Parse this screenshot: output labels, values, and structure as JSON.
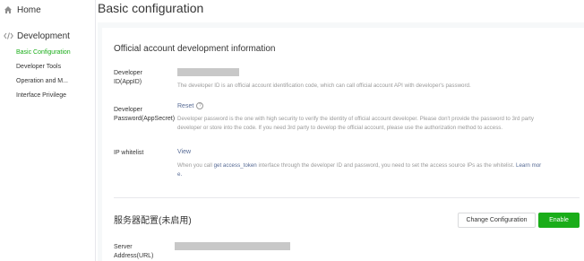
{
  "sidebar": {
    "home_label": "Home",
    "development_label": "Development",
    "items": [
      {
        "label": "Basic Configuration"
      },
      {
        "label": "Developer Tools"
      },
      {
        "label": "Operation and M..."
      },
      {
        "label": "Interface Privilege"
      }
    ]
  },
  "page": {
    "title": "Basic configuration"
  },
  "dev_info": {
    "section_title": "Official account development information",
    "appid": {
      "label_line1": "Developer",
      "label_line2": "ID(AppID)",
      "desc": "The developer ID is an official account identification code, which can call official account API with developer's password."
    },
    "appsecret": {
      "label_line1": "Developer",
      "label_line2": "Password(AppSecret)",
      "action": "Reset",
      "help_icon": "?",
      "desc_line1": "Developer password is the one with high security to verify the identity of official account developer. Please don't provide the password to 3rd party",
      "desc_line2": "developer or store into the code. If you need 3rd party to develop the official account, please use the authorization method to access."
    },
    "whitelist": {
      "label": "IP whitelist",
      "action": "View",
      "desc_pre": "When you call ",
      "desc_link": "get access_token",
      "desc_post": " interface through the developer ID and password, you need to set the access source IPs as the whitelist.",
      "desc_learn": "Learn mor",
      "desc_learn2": "e."
    }
  },
  "server": {
    "section_title": "服务器配置(未启用)",
    "change_button": "Change Configuration",
    "enable_button": "Enable",
    "url_label_line1": "Server",
    "url_label_line2": "Address(URL)"
  },
  "colors": {
    "accent": "#1aad19",
    "link": "#576b95",
    "muted": "#9a9a9a"
  }
}
